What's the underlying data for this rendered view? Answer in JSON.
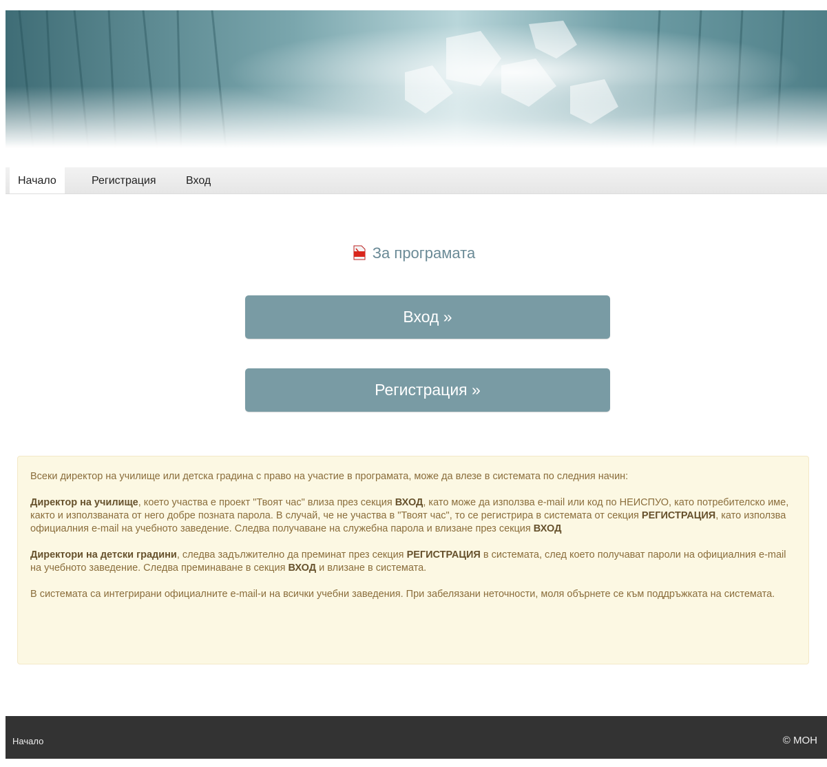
{
  "nav": {
    "items": [
      "Начало",
      "Регистрация",
      "Вход"
    ]
  },
  "about_link": "За програмата",
  "buttons": {
    "login": "Вход »",
    "register": "Регистрация »"
  },
  "notice": {
    "intro": "Всеки директор на училище или детска градина с право на участие в програмата, може да влезе в системата по следния начин:",
    "p1": {
      "bold1": "Директор на училище",
      "text1": ", което участва е проект \"Твоят час\" влиза през секция ",
      "bold2": "ВХОД",
      "text2": ", като може да използва e-mail или код по НЕИСПУО, като потребителско име, както и използваната от него добре позната парола. В случай, че не участва в \"Твоят час\", то се регистрира в системата от секция ",
      "bold3": "РЕГИСТРАЦИЯ",
      "text3": ", като използва официалния e-mail на учебното заведение. Следва получаване на служебна парола и влизане през секция ",
      "bold4": "ВХОД"
    },
    "p2": {
      "bold1": "Директори на детски градини",
      "text1": ", следва задължително да преминат през секция ",
      "bold2": "РЕГИСТРАЦИЯ",
      "text2": " в системата, след което получават пароли на официалния e-mail на учебното заведение. Следва преминаване в секция ",
      "bold3": "ВХОД",
      "text3": " и влизане в системата."
    },
    "p3": "В системата са интегрирани официалните e-mail-и на всички учебни заведения. При забелязани неточности, моля обърнете се към поддръжката на системата."
  },
  "footer": {
    "home": "Начало",
    "copyright": "© МОН"
  },
  "colors": {
    "button": "#799ba4",
    "notice_bg": "#fcf8e3",
    "notice_text": "#8a6d3b",
    "footer_bg": "#333333",
    "link": "#6a8a96"
  },
  "icons": {
    "about": "pdf-icon",
    "banner": "abstract-teal-header-image"
  }
}
